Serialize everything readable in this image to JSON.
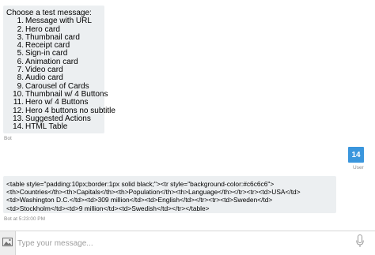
{
  "menu": {
    "intro": "Choose a test message:",
    "items": [
      {
        "num": "1.",
        "label": "Message with URL"
      },
      {
        "num": "2.",
        "label": "Hero card"
      },
      {
        "num": "3.",
        "label": "Thumbnail card"
      },
      {
        "num": "4.",
        "label": "Receipt card"
      },
      {
        "num": "5.",
        "label": "Sign-in card"
      },
      {
        "num": "6.",
        "label": "Animation card"
      },
      {
        "num": "7.",
        "label": "Video card"
      },
      {
        "num": "8.",
        "label": "Audio card"
      },
      {
        "num": "9.",
        "label": "Carousel of Cards"
      },
      {
        "num": "10.",
        "label": "Thumbnail w/ 4 Buttons"
      },
      {
        "num": "11.",
        "label": "Hero w/ 4 Buttons"
      },
      {
        "num": "12.",
        "label": "Hero 4 buttons no subtitle"
      },
      {
        "num": "13.",
        "label": "Suggested Actions"
      },
      {
        "num": "14.",
        "label": "HTML Table"
      }
    ],
    "sender": "Bot"
  },
  "user_message": {
    "text": "14",
    "sender": "User"
  },
  "table_message": {
    "lines": [
      "<table style=\"padding:10px;border:1px solid black;\"><tr style=\"background-color:#c6c6c6\">",
      "<th>Countries</th><th>Capitals</th><th>Population</th><th>Language</th></tr><tr><td>USA</td>",
      "<td>Washington D.C.</td><td>309 million</td><td>English</td></tr><tr><td>Sweden</td>",
      "<td>Stockholm</td><td>9 million</td><td>Swedish</td></tr></table>"
    ],
    "meta": "Bot at 5:23:00 PM"
  },
  "input": {
    "placeholder": "Type your message..."
  },
  "icons": {
    "upload": "image-upload-icon",
    "mic": "microphone-icon"
  },
  "colors": {
    "bot_bubble": "#eceff1",
    "user_bubble": "#3a96dd"
  }
}
